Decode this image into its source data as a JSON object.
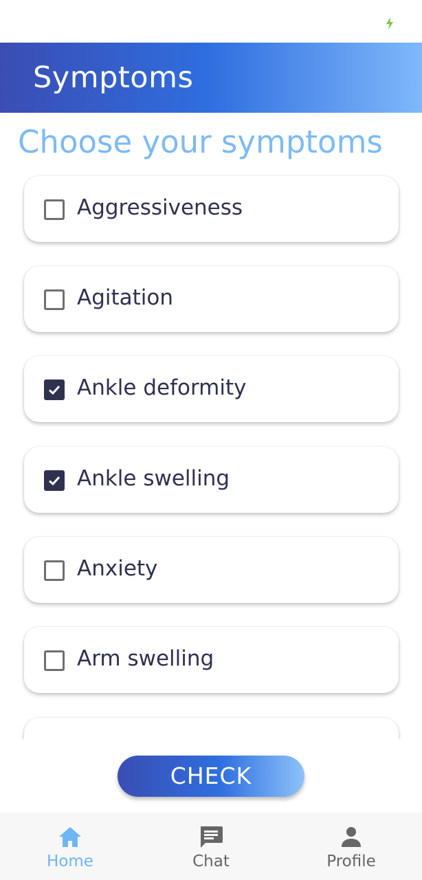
{
  "app_bar": {
    "title": "Symptoms"
  },
  "heading": "Choose your symptoms",
  "symptoms": [
    {
      "label": "Aggressiveness",
      "checked": false
    },
    {
      "label": "Agitation",
      "checked": false
    },
    {
      "label": "Ankle deformity",
      "checked": true
    },
    {
      "label": "Ankle swelling",
      "checked": true
    },
    {
      "label": "Anxiety",
      "checked": false
    },
    {
      "label": "Arm swelling",
      "checked": false
    }
  ],
  "check_button": {
    "label": "CHECK"
  },
  "bottom_nav": {
    "items": [
      {
        "label": "Home",
        "icon": "home-icon",
        "active": true
      },
      {
        "label": "Chat",
        "icon": "chat-icon",
        "active": false
      },
      {
        "label": "Profile",
        "icon": "person-icon",
        "active": false
      }
    ]
  },
  "colors": {
    "app_bar_gradient": [
      "#3a4db3",
      "#2f6fe0",
      "#7fb8fb"
    ],
    "heading": "#7cbaf5",
    "text": "#2f3150",
    "nav_active": "#6eb5f6",
    "nav_inactive": "#666666"
  }
}
